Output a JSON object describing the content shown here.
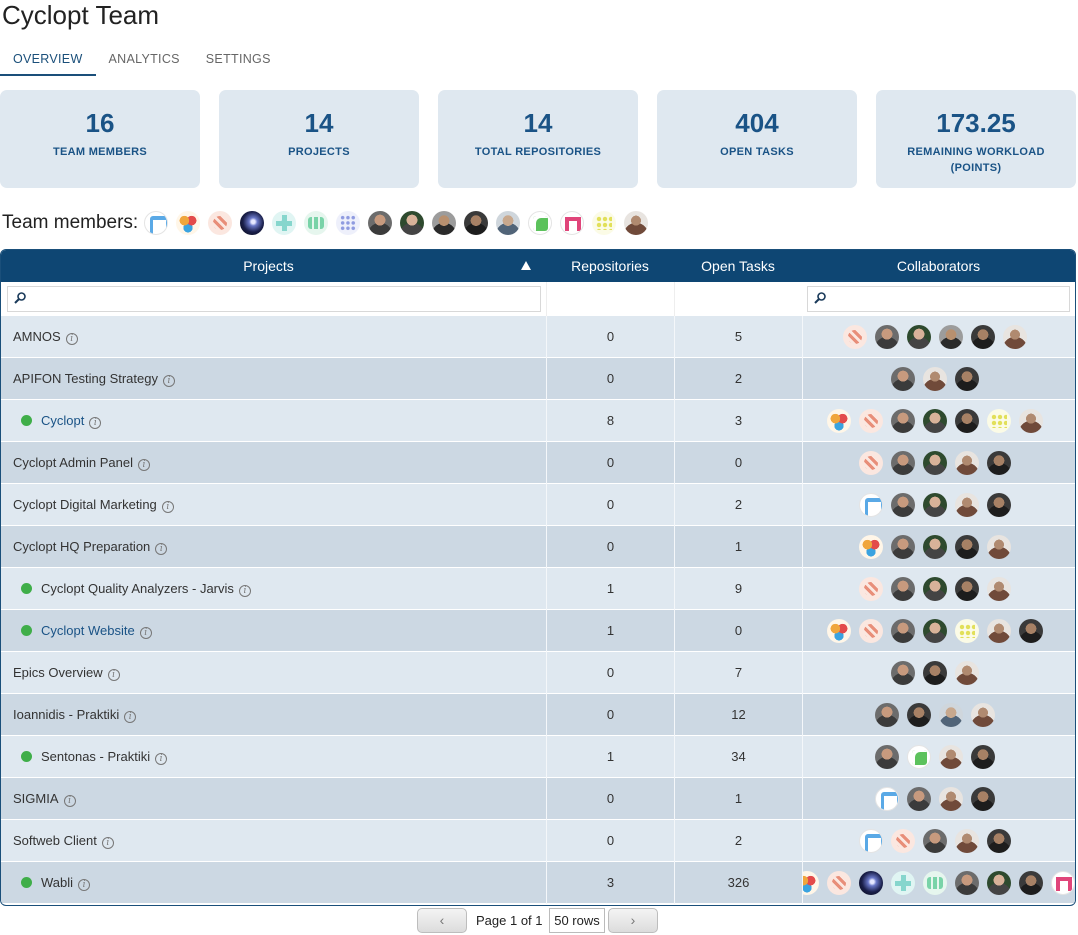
{
  "page": {
    "title": "Cyclopt Team"
  },
  "tabs": [
    {
      "label": "OVERVIEW",
      "active": true
    },
    {
      "label": "ANALYTICS",
      "active": false
    },
    {
      "label": "SETTINGS",
      "active": false
    }
  ],
  "stats": [
    {
      "value": "16",
      "label": "TEAM MEMBERS"
    },
    {
      "value": "14",
      "label": "PROJECTS"
    },
    {
      "value": "14",
      "label": "TOTAL REPOSITORIES"
    },
    {
      "value": "404",
      "label": "OPEN TASKS"
    },
    {
      "value": "173.25",
      "label": "REMAINING WORKLOAD (POINTS)"
    }
  ],
  "team": {
    "label": "Team members:",
    "avatars": [
      "ident-blue",
      "ident-multi",
      "ident-red",
      "galaxy",
      "ident-teal",
      "ident-mint",
      "ident-grid",
      "photo",
      "photo p2",
      "photo p3",
      "photo p4",
      "photo p5",
      "ident-green",
      "ident-pink",
      "ident-yellow",
      "photo p6"
    ]
  },
  "grid": {
    "columns": {
      "projects": "Projects",
      "repositories": "Repositories",
      "open_tasks": "Open Tasks",
      "collaborators": "Collaborators"
    },
    "sort": {
      "column": "projects",
      "direction": "ascending"
    },
    "filters": {
      "projects_value": "",
      "collaborators_value": ""
    },
    "rows": [
      {
        "name": "AMNOS",
        "active": false,
        "repositories": "0",
        "open_tasks": "5",
        "collaborators": [
          "ident-red",
          "photo",
          "photo p2",
          "photo p3",
          "photo p4",
          "photo p6"
        ]
      },
      {
        "name": "APIFON Testing Strategy",
        "active": false,
        "repositories": "0",
        "open_tasks": "2",
        "collaborators": [
          "photo",
          "photo p6",
          "photo p4"
        ]
      },
      {
        "name": "Cyclopt",
        "active": true,
        "repositories": "8",
        "open_tasks": "3",
        "collaborators": [
          "ident-multi",
          "ident-red",
          "photo",
          "photo p2",
          "photo p4",
          "ident-yellow",
          "photo p6"
        ]
      },
      {
        "name": "Cyclopt Admin Panel",
        "active": false,
        "repositories": "0",
        "open_tasks": "0",
        "collaborators": [
          "ident-red",
          "photo",
          "photo p2",
          "photo p6",
          "photo p4"
        ]
      },
      {
        "name": "Cyclopt Digital Marketing",
        "active": false,
        "repositories": "0",
        "open_tasks": "2",
        "collaborators": [
          "ident-blue",
          "photo",
          "photo p2",
          "photo p6",
          "photo p4"
        ]
      },
      {
        "name": "Cyclopt HQ Preparation",
        "active": false,
        "repositories": "0",
        "open_tasks": "1",
        "collaborators": [
          "ident-multi",
          "photo",
          "photo p2",
          "photo p4",
          "photo p6"
        ]
      },
      {
        "name": "Cyclopt Quality Analyzers - Jarvis",
        "active": true,
        "repositories": "1",
        "open_tasks": "9",
        "collaborators": [
          "ident-red",
          "photo",
          "photo p2",
          "photo p4",
          "photo p6"
        ]
      },
      {
        "name": "Cyclopt Website",
        "active": true,
        "repositories": "1",
        "open_tasks": "0",
        "collaborators": [
          "ident-multi",
          "ident-red",
          "photo",
          "photo p2",
          "ident-yellow",
          "photo p6",
          "photo p4"
        ]
      },
      {
        "name": "Epics Overview",
        "active": false,
        "repositories": "0",
        "open_tasks": "7",
        "collaborators": [
          "photo",
          "photo p4",
          "photo p6"
        ]
      },
      {
        "name": "Ioannidis - Praktiki",
        "active": false,
        "repositories": "0",
        "open_tasks": "12",
        "collaborators": [
          "photo",
          "photo p4",
          "photo p5",
          "photo p6"
        ]
      },
      {
        "name": "Sentonas - Praktiki",
        "active": true,
        "repositories": "1",
        "open_tasks": "34",
        "collaborators": [
          "photo",
          "ident-green",
          "photo p6",
          "photo p4"
        ]
      },
      {
        "name": "SIGMIA",
        "active": false,
        "repositories": "0",
        "open_tasks": "1",
        "collaborators": [
          "ident-blue",
          "photo",
          "photo p6",
          "photo p4"
        ]
      },
      {
        "name": "Softweb Client",
        "active": false,
        "repositories": "0",
        "open_tasks": "2",
        "collaborators": [
          "ident-blue",
          "ident-red",
          "photo",
          "photo p6",
          "photo p4"
        ]
      },
      {
        "name": "Wabli",
        "active": true,
        "repositories": "3",
        "open_tasks": "326",
        "collaborators": [
          "ident-multi",
          "ident-red",
          "galaxy",
          "ident-teal",
          "ident-mint",
          "photo",
          "photo p2",
          "photo p4",
          "ident-pink"
        ]
      }
    ]
  },
  "pager": {
    "prev": "‹",
    "next": "›",
    "info": "Page 1 of 1",
    "rows_label": "50 rows"
  },
  "colors": {
    "accent": "#0e4673",
    "card": "#dfe8f0",
    "row_odd": "#dfe8f0",
    "row_even": "#ccd8e3",
    "active_dot": "#3fae49",
    "stat_text": "#1a5386"
  }
}
